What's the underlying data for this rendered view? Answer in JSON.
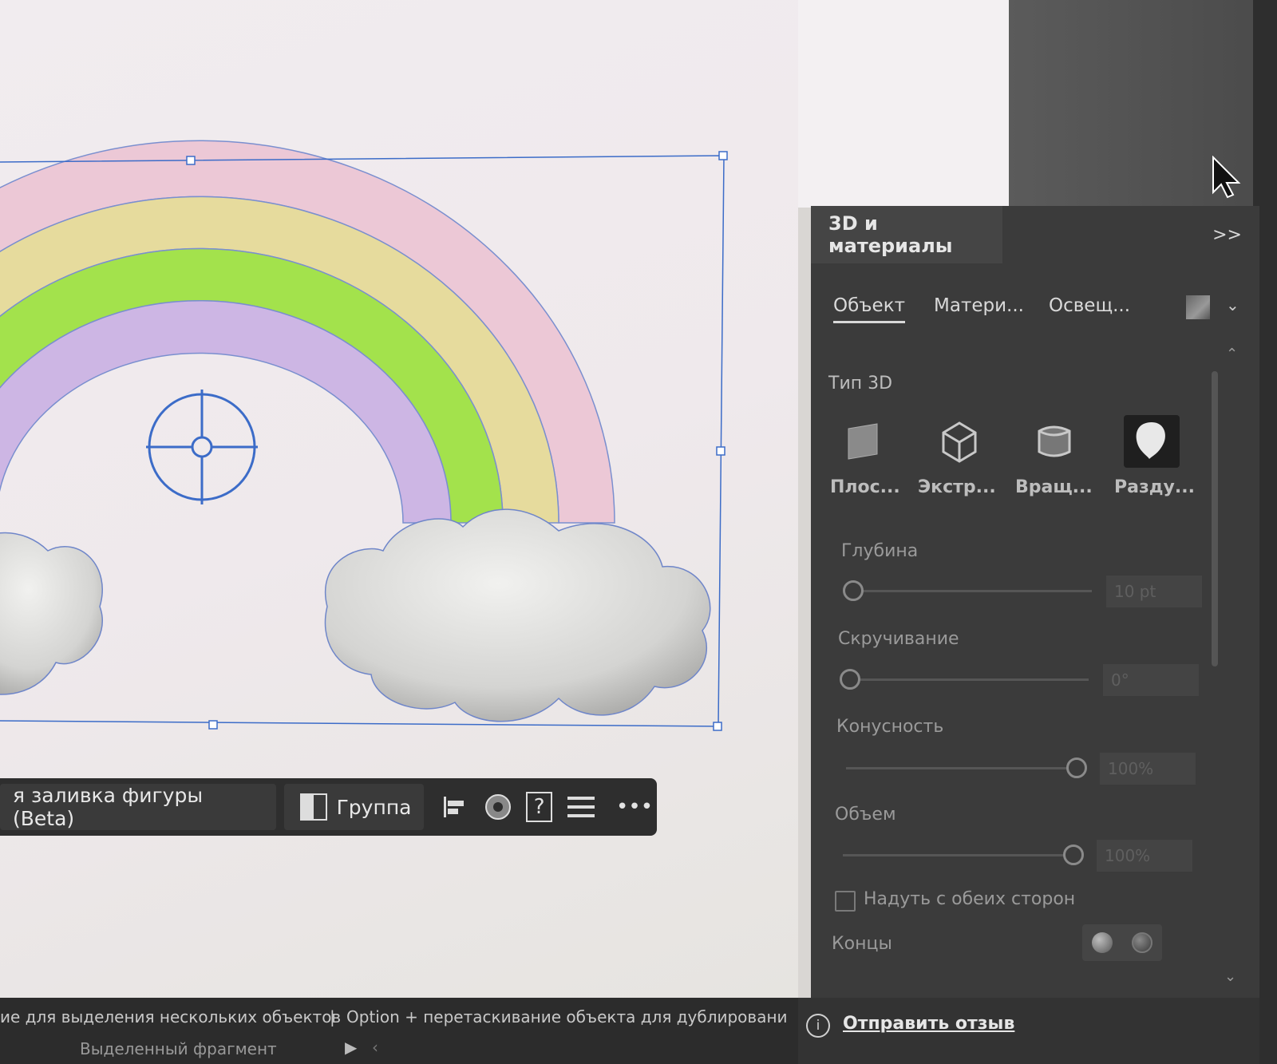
{
  "context_bar": {
    "fill_label": "я заливка фигуры (Beta)",
    "group_label": "Группа",
    "help_label": "?",
    "more_label": "•••"
  },
  "panel": {
    "title": "3D и материалы",
    "collapse_label": ">>",
    "tabs": [
      {
        "label": "Объект",
        "active": true
      },
      {
        "label": "Матери..."
      },
      {
        "label": "Освещ..."
      }
    ],
    "type_3d_label": "Тип 3D",
    "types": [
      {
        "label": "Плос...",
        "icon": "plane-icon"
      },
      {
        "label": "Экстр...",
        "icon": "extrude-cube-icon"
      },
      {
        "label": "Вращ...",
        "icon": "revolve-icon"
      },
      {
        "label": "Разду...",
        "icon": "inflate-balloon-icon",
        "selected": true
      }
    ],
    "depth": {
      "label": "Глубина",
      "value": "10 pt",
      "level": 0
    },
    "twist": {
      "label": "Скручивание",
      "value": "0°",
      "level": 0
    },
    "taper": {
      "label": "Конусность",
      "value": "100%",
      "level": 1
    },
    "volume": {
      "label": "Объем",
      "value": "100%",
      "level": 1
    },
    "inflate_both_label": "Надуть с обеих сторон",
    "caps_label": "Концы"
  },
  "status_bar": {
    "hint_left": "ие для выделения нескольких объектов",
    "separator": "|",
    "hint_right": "Option + перетаскивание объекта для дублировани",
    "selection_label": "Выделенный фрагмент",
    "feedback_label": "Отправить отзыв"
  },
  "colors": {
    "rainbow_pink": "#ecc8d6",
    "rainbow_yellow": "#e6db9d",
    "rainbow_green": "#a3e24c",
    "rainbow_purple": "#cdb6e4",
    "selection_blue": "#3c6cc8",
    "panel_bg": "#3b3b3b"
  }
}
